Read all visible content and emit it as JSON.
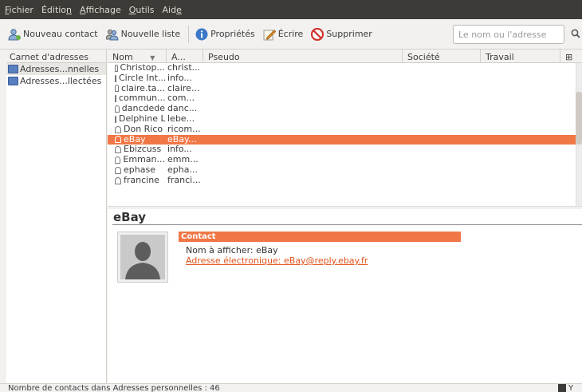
{
  "menubar": {
    "items": [
      {
        "pre": "",
        "ul": "F",
        "post": "ichier"
      },
      {
        "pre": "Éditio",
        "ul": "n",
        "post": ""
      },
      {
        "pre": "",
        "ul": "A",
        "post": "ffichage"
      },
      {
        "pre": "",
        "ul": "O",
        "post": "utils"
      },
      {
        "pre": "Aid",
        "ul": "e",
        "post": ""
      }
    ]
  },
  "toolbar": {
    "new_contact": "Nouveau contact",
    "new_list": "Nouvelle liste",
    "properties": "Propriétés",
    "write": "Écrire",
    "delete": "Supprimer",
    "search_placeholder": "Le nom ou l'adresse"
  },
  "address_books": {
    "header": "Carnet d'adresses",
    "items": [
      "Adresses...nnelles",
      "Adresses...llectées"
    ]
  },
  "columns": [
    "Nom",
    "A...",
    "Pseudo",
    "Société",
    "Travail"
  ],
  "contacts": [
    {
      "name": "Christop...",
      "email": "christ..."
    },
    {
      "name": "Circle Int...",
      "email": "info..."
    },
    {
      "name": "claire.ta...",
      "email": "claire..."
    },
    {
      "name": "commun...",
      "email": "com..."
    },
    {
      "name": "dancdede",
      "email": "danc..."
    },
    {
      "name": "Delphine L",
      "email": "lebe..."
    },
    {
      "name": "Don Rico",
      "email": "ricom..."
    },
    {
      "name": "eBay",
      "email": "eBay..."
    },
    {
      "name": "Ebizcuss",
      "email": "info..."
    },
    {
      "name": "Emman...",
      "email": "emm..."
    },
    {
      "name": "ephase",
      "email": "epha..."
    },
    {
      "name": "francine",
      "email": "franci..."
    }
  ],
  "detail": {
    "name": "eBay",
    "section": "Contact",
    "display_name": "Nom à afficher: eBay",
    "email_line": "Adresse électronique: eBay@reply.ebay.fr"
  },
  "status": {
    "text": "Nombre de contacts dans Adresses personnelles : 46",
    "y": "Y"
  },
  "colors": {
    "selection": "#f07746",
    "menubar": "#3c3b37"
  }
}
